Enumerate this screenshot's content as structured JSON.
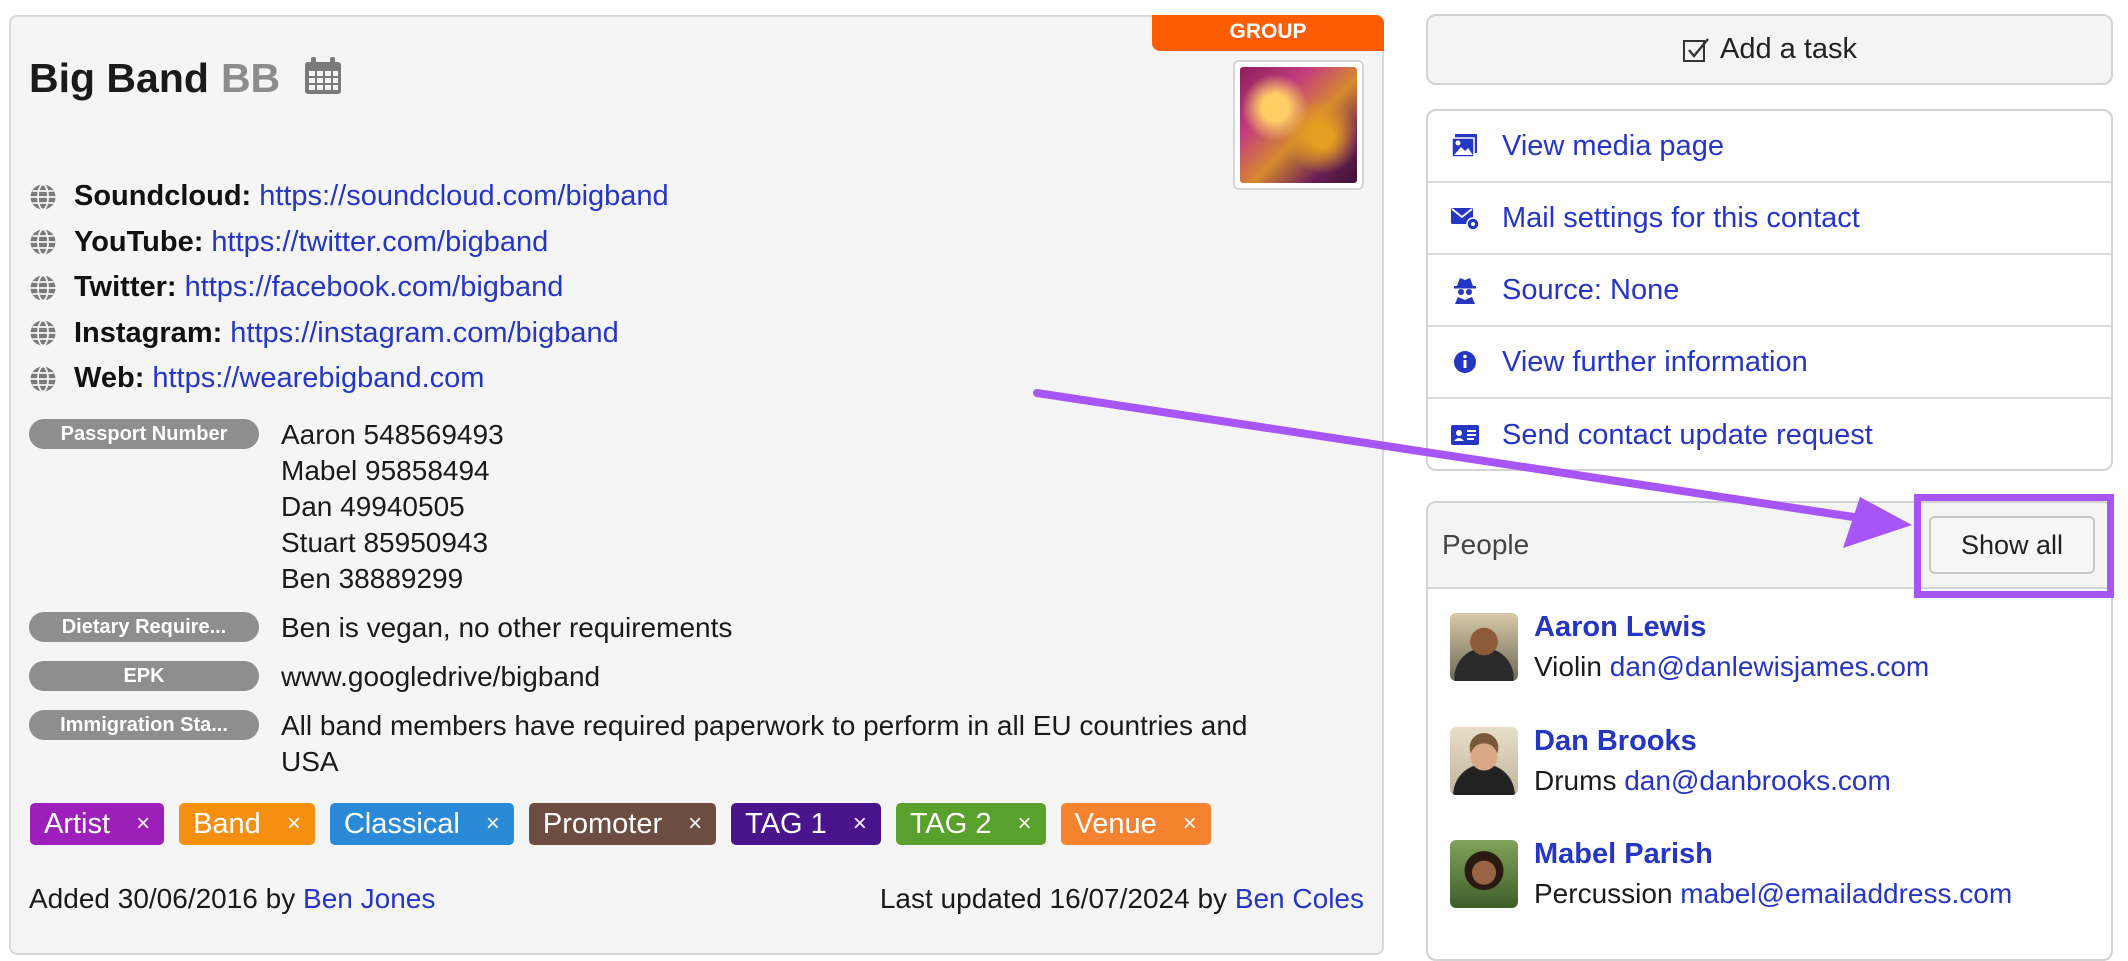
{
  "contact": {
    "badge": "GROUP",
    "name": "Big Band",
    "abbr": "BB",
    "links": [
      {
        "label": "Soundcloud:",
        "url": "https://soundcloud.com/bigband"
      },
      {
        "label": "YouTube:",
        "url": "https://twitter.com/bigband"
      },
      {
        "label": "Twitter:",
        "url": "https://facebook.com/bigband"
      },
      {
        "label": "Instagram:",
        "url": "https://instagram.com/bigband"
      },
      {
        "label": "Web:",
        "url": "https://wearebigband.com"
      }
    ],
    "fields": {
      "passport": {
        "label": "Passport Number",
        "values": [
          "Aaron 548569493",
          "Mabel 95858494",
          "Dan 49940505",
          "Stuart 85950943",
          "Ben 38889299"
        ]
      },
      "dietary": {
        "label": "Dietary Require...",
        "value": "Ben is vegan, no other requirements"
      },
      "epk": {
        "label": "EPK",
        "value": "www.googledrive/bigband"
      },
      "immigration": {
        "label": "Immigration Sta...",
        "value_line1": "All band members have required paperwork to perform in all EU countries and",
        "value_line2": "USA"
      }
    },
    "tags": [
      {
        "label": "Artist",
        "color": "#9b1fb8"
      },
      {
        "label": "Band",
        "color": "#f5900f"
      },
      {
        "label": "Classical",
        "color": "#2a8ad8"
      },
      {
        "label": "Promoter",
        "color": "#6d4c41"
      },
      {
        "label": "TAG 1",
        "color": "#4a148c"
      },
      {
        "label": "TAG 2",
        "color": "#5aa02c"
      },
      {
        "label": "Venue",
        "color": "#f5822e"
      }
    ],
    "tag_remove": "×",
    "added": {
      "prefix": "Added 30/06/2016 by",
      "user": "Ben Jones"
    },
    "updated": {
      "prefix": "Last updated 16/07/2024 by",
      "user": "Ben Coles"
    }
  },
  "sidebar": {
    "add_task": "Add a task",
    "menu": [
      {
        "label": "View media page",
        "icon": "image-icon"
      },
      {
        "label": "Mail settings for this contact",
        "icon": "mail-settings-icon"
      },
      {
        "label": "Source: None",
        "icon": "spy-icon"
      },
      {
        "label": "View further information",
        "icon": "info-icon"
      },
      {
        "label": "Send contact update request",
        "icon": "id-card-icon"
      }
    ],
    "people": {
      "title": "People",
      "show_all": "Show all",
      "list": [
        {
          "name": "Aaron Lewis",
          "role": "Violin",
          "email": "dan@danlewisjames.com"
        },
        {
          "name": "Dan Brooks",
          "role": "Drums",
          "email": "dan@danbrooks.com"
        },
        {
          "name": "Mabel Parish",
          "role": "Percussion",
          "email": "mabel@emailaddress.com"
        }
      ]
    }
  },
  "annotation": {
    "color": "#a855f7"
  }
}
